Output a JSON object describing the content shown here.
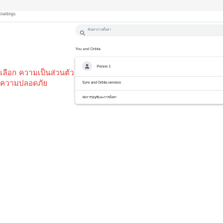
{
  "browser": {
    "tab_text": "/settings"
  },
  "search": {
    "placeholder": "ค้นหาการตั้งค่า",
    "icon": "search-icon"
  },
  "section": {
    "title": "You and Orbita"
  },
  "card": {
    "profile_name": "Person 1",
    "sync_label": "Sync and Orbita services",
    "name_label": "จัดการบัญชีและการตั้งค่า"
  },
  "overlay": {
    "line1": "เลือก ความเป็นส่วนตัว",
    "line2": "ความปลอดภัย",
    "color": "#e53935"
  }
}
